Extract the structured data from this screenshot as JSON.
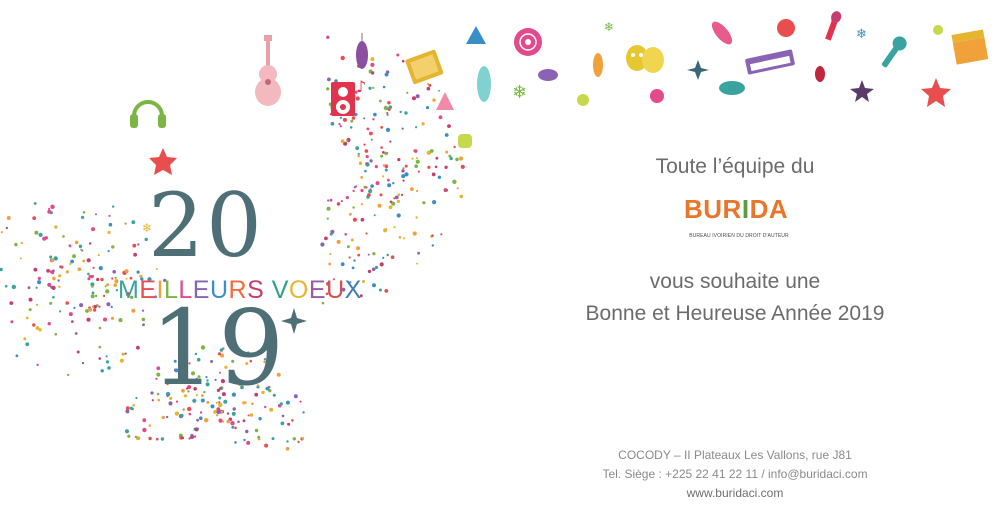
{
  "card": {
    "year_top": "20",
    "year_bottom": "19",
    "voeux_text": "MEILLEURS VOEUX",
    "voeux_colors": [
      "#3aa3a0",
      "#e84e4e",
      "#f0a13a",
      "#7bb543",
      "#e24a8b",
      "#8a63b5",
      "#3b8fc7",
      "#f26b3a",
      "#c63e6d",
      "#2f9e8f",
      "#e6b530",
      "#9a5aa8",
      "#d94f4f",
      "#3f7fb3",
      "#f08a3a"
    ],
    "year_color": "#4f6f77"
  },
  "greeting": {
    "line_team": "Toute l’équipe du",
    "line_wish": "vous souhaite une",
    "line_year": "Bonne et Heureuse Année 2019"
  },
  "logo": {
    "name_part1": "BUR",
    "name_accent": "I",
    "name_part2": "DA",
    "subtitle": "BUREAU IVOIRIEN DU DROIT D'AUTEUR",
    "brand_color": "#e8772b",
    "accent_color": "#5d9c47"
  },
  "contact": {
    "address": "COCODY – II Plateaux Les Vallons, rue J81",
    "phone": "Tel. Siège : +225 22 41 22 11 / info@buridaci.com",
    "website": "www.buridaci.com"
  },
  "decorations": {
    "icons": [
      "headphones-icon",
      "star-icon",
      "guitar-icon",
      "speaker-icon",
      "music-note-icon",
      "ornament-icon",
      "book-icon",
      "tree-icon",
      "vinyl-icon",
      "theater-masks-icon",
      "keyboard-icon",
      "microphone-icon",
      "paintbrush-icon",
      "clapperboard-icon",
      "snowflake-icon",
      "sparkle-icon"
    ],
    "colors": [
      "#7bb543",
      "#e84e4e",
      "#e24a8b",
      "#f0a13a",
      "#3aa3a0",
      "#8a63b5",
      "#3b8fc7",
      "#e6b530",
      "#c63e6d"
    ]
  }
}
